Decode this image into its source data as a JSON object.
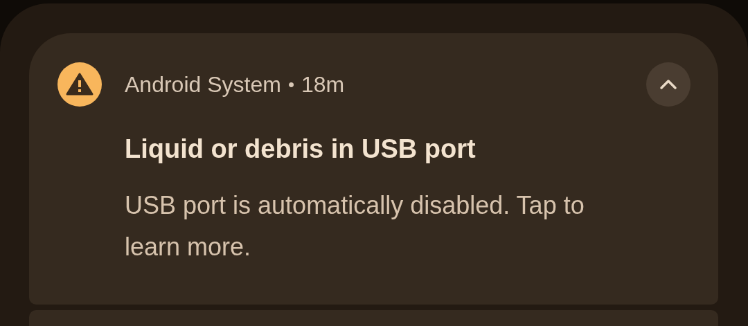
{
  "notification": {
    "app_name": "Android System",
    "separator": "•",
    "time": "18m",
    "expanded": true,
    "title": "Liquid or debris in USB port",
    "body": "USB port is automatically disabled. Tap to learn more."
  }
}
